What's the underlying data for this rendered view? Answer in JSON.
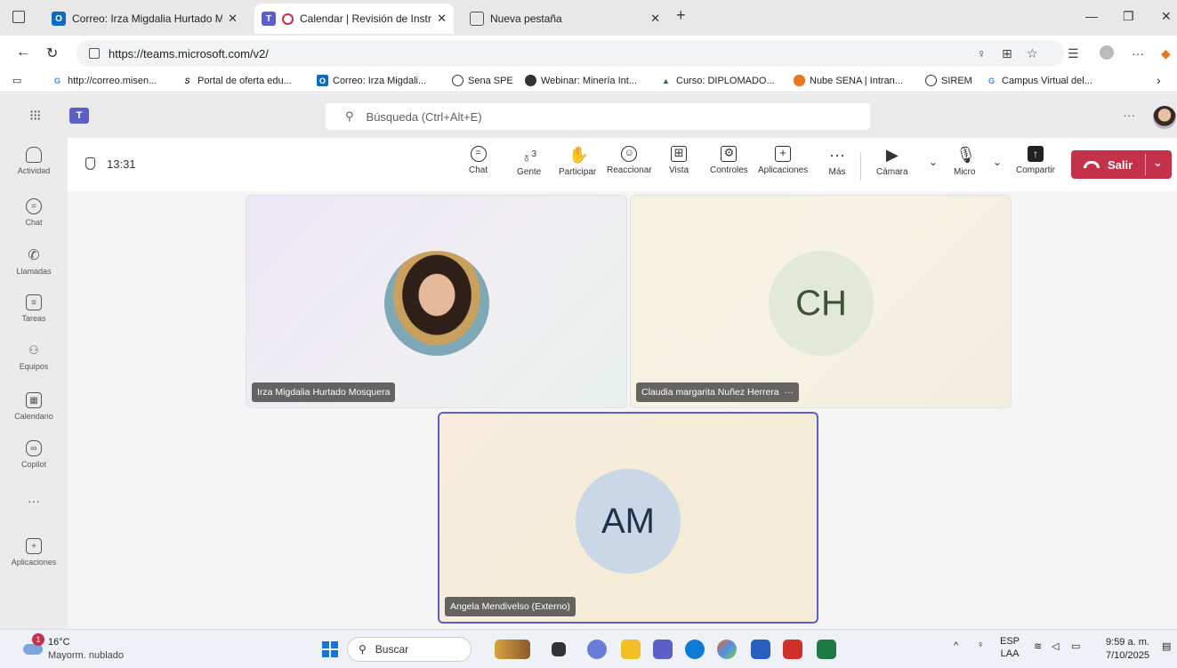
{
  "browser": {
    "tabs": [
      {
        "label": "Correo: Irza Migdalia Hurtado Mo",
        "icon": "outlook-icon"
      },
      {
        "label": "Calendar | Revisión de Instru",
        "icon": "teams-icon"
      },
      {
        "label": "Nueva pestaña",
        "icon": "newtab-icon"
      }
    ],
    "url": "https://teams.microsoft.com/v2/",
    "bookmarks": [
      "http://correo.misen...",
      "Portal de oferta edu...",
      "Correo: Irza Migdali...",
      "Sena SPE",
      "Webinar: Minería Int...",
      "Curso: DIPLOMADO...",
      "Nube SENA | Intran...",
      "SIREM",
      "Campus Virtual del..."
    ]
  },
  "teams": {
    "search_placeholder": "Búsqueda (Ctrl+Alt+E)",
    "rail": [
      "Actividad",
      "Chat",
      "Llamadas",
      "Tareas",
      "Equipos",
      "Calendario",
      "Copilot",
      "Aplicaciones"
    ]
  },
  "meeting": {
    "timer": "13:31",
    "people_count": "3",
    "toolbar": {
      "chat": "Chat",
      "people": "Gente",
      "raise": "Participar",
      "react": "Reaccionar",
      "view": "Vista",
      "controls": "Controles",
      "apps": "Aplicaciones",
      "more": "Más",
      "camera": "Cámara",
      "mic": "Micro",
      "share": "Compartir",
      "leave": "Salir"
    },
    "participants": [
      {
        "name": "Irza Migdalia Hurtado Mosquera",
        "initials": ""
      },
      {
        "name": "Claudia margarita Nuñez Herrera",
        "initials": "CH"
      },
      {
        "name": "Angela Mendivelso (Externo)",
        "initials": "AM"
      }
    ]
  },
  "taskbar": {
    "weather_temp": "16°C",
    "weather_desc": "Mayorm. nublado",
    "weather_badge": "1",
    "search_label": "Buscar",
    "lang": "ESP",
    "lang_sub": "LAA",
    "time": "9:59 a. m.",
    "date": "7/10/2025"
  },
  "colors": {
    "teams_accent": "#5b5fc7",
    "leave_red": "#c4314b"
  }
}
